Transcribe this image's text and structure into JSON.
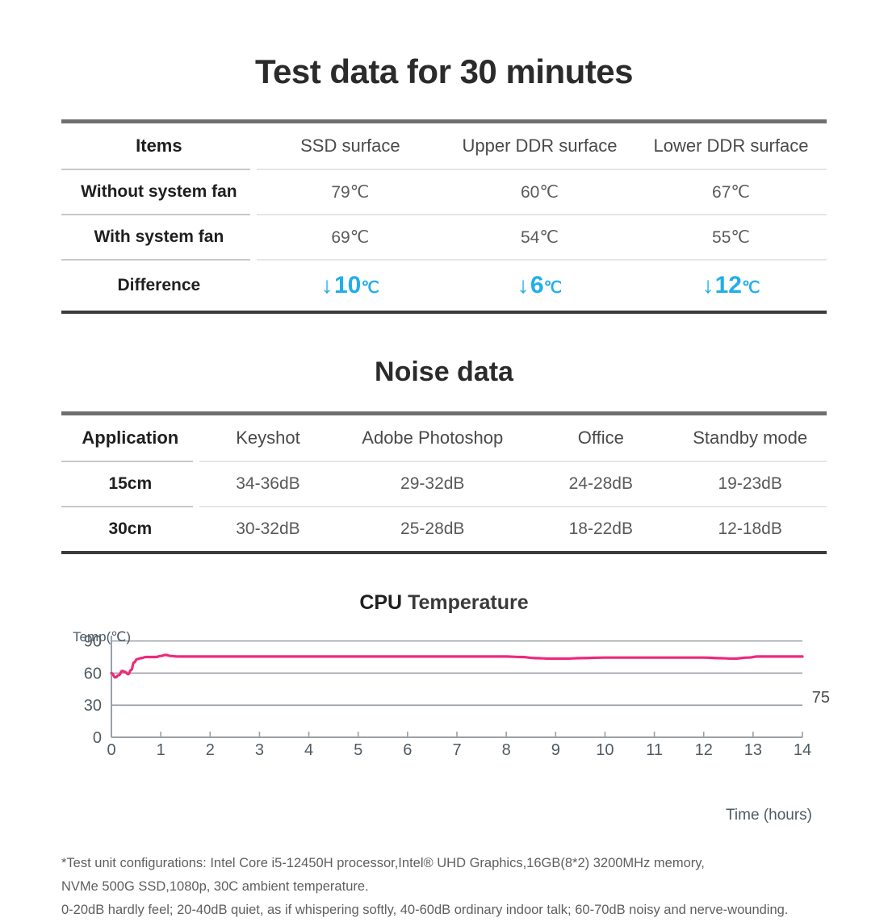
{
  "page": {
    "title": "Test data for 30 minutes"
  },
  "thermal_table": {
    "headers": [
      "Items",
      "SSD surface",
      "Upper DDR surface",
      "Lower DDR surface"
    ],
    "rows": [
      {
        "label": "Without system fan",
        "values": [
          "79℃",
          "60℃",
          "67℃"
        ]
      },
      {
        "label": "With system fan",
        "values": [
          "69℃",
          "54℃",
          "55℃"
        ]
      }
    ],
    "difference": {
      "label": "Difference",
      "arrow": "↓",
      "values": [
        "10",
        "6",
        "12"
      ],
      "unit": "℃",
      "color": "#22aeea"
    }
  },
  "noise_section": {
    "title": "Noise data",
    "headers": [
      "Application",
      "Keyshot",
      "Adobe Photoshop",
      "Office",
      "Standby mode"
    ],
    "rows": [
      {
        "label": "15cm",
        "values": [
          "34-36dB",
          "29-32dB",
          "24-28dB",
          "19-23dB"
        ]
      },
      {
        "label": "30cm",
        "values": [
          "30-32dB",
          "25-28dB",
          "18-22dB",
          "12-18dB"
        ]
      }
    ]
  },
  "chart_data": {
    "type": "line",
    "title_bold": "CPU",
    "title_rest": " Temperature",
    "title": "CPU Temperature",
    "ylabel": "Temp(℃)",
    "xlabel": "Time (hours)",
    "xlim": [
      0,
      14
    ],
    "ylim": [
      0,
      95
    ],
    "yticks": [
      0,
      30,
      60,
      90
    ],
    "xticks": [
      0,
      1,
      2,
      3,
      4,
      5,
      6,
      7,
      8,
      9,
      10,
      11,
      12,
      13,
      14
    ],
    "grid": true,
    "legend": "none",
    "line_color": "#ec2a7b",
    "endpoint_annotation": "75",
    "series": [
      {
        "name": "CPU Temperature",
        "x": [
          0.0,
          0.08,
          0.15,
          0.22,
          0.28,
          0.34,
          0.4,
          0.46,
          0.52,
          0.6,
          0.7,
          0.8,
          0.9,
          1.0,
          1.1,
          1.2,
          1.35,
          1.5,
          2.0,
          2.5,
          3.0,
          3.5,
          4.0,
          4.5,
          5.0,
          5.5,
          6.0,
          6.5,
          7.0,
          7.5,
          8.0,
          8.3,
          8.6,
          8.9,
          9.2,
          9.5,
          10.0,
          10.5,
          11.0,
          11.5,
          12.0,
          12.3,
          12.6,
          12.9,
          13.1,
          13.3,
          13.6,
          14.0
        ],
        "y": [
          60,
          56,
          58,
          62,
          61,
          59,
          63,
          70,
          73,
          74,
          75,
          75,
          75,
          76,
          77,
          76,
          75.5,
          75.5,
          75.5,
          75.5,
          75.5,
          75.5,
          75.5,
          75.5,
          75.5,
          75.5,
          75.5,
          75.5,
          75.5,
          75.5,
          75.5,
          75,
          74,
          73.5,
          73.5,
          74,
          74.5,
          74.5,
          74.5,
          74.5,
          74.5,
          74,
          73.5,
          74.5,
          75.5,
          75.5,
          75.5,
          75.5
        ]
      }
    ]
  },
  "footnotes": [
    "*Test unit configurations: Intel Core i5-12450H processor,Intel® UHD Graphics,16GB(8*2) 3200MHz memory,",
    "NVMe 500G SSD,1080p, 30C ambient temperature.",
    "0-20dB hardly feel; 20-40dB quiet, as if whispering softly, 40-60dB ordinary indoor talk; 60-70dB noisy and nerve-wounding."
  ]
}
